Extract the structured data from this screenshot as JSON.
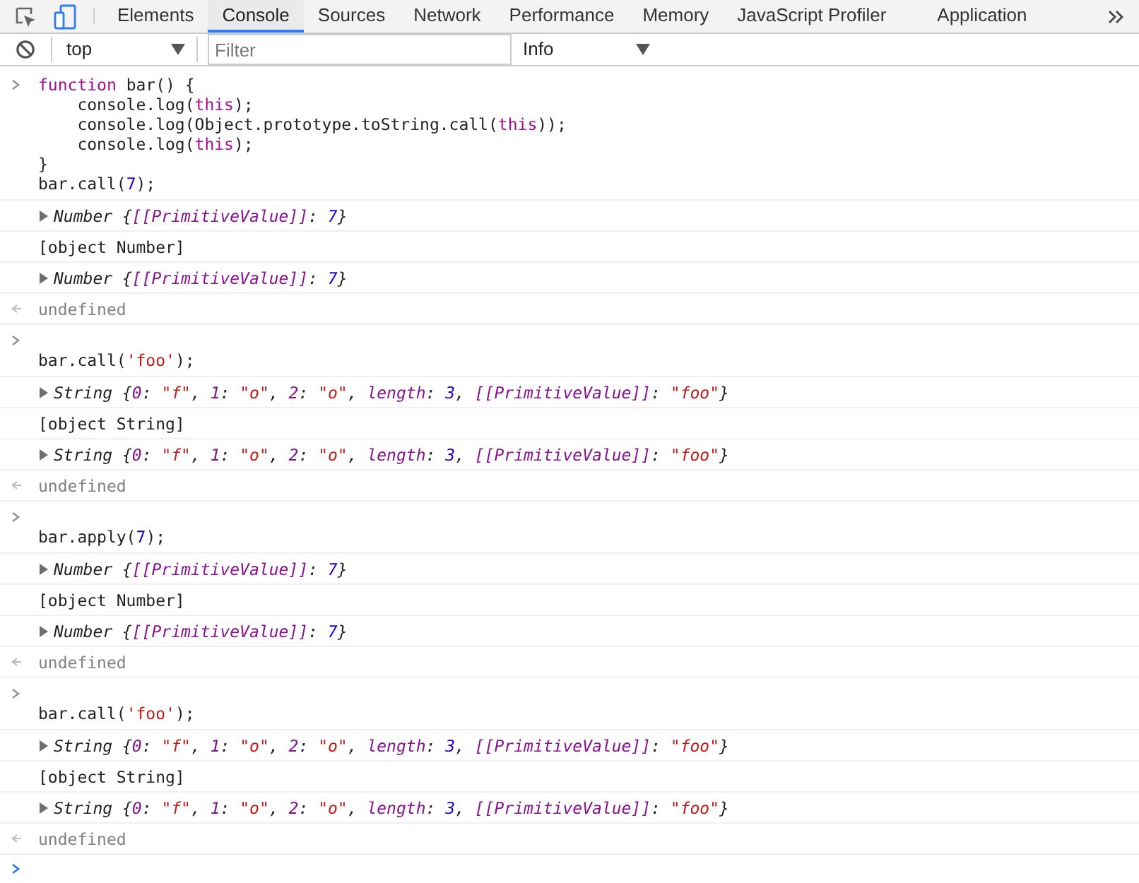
{
  "tabs": [
    {
      "label": "Elements",
      "selected": false
    },
    {
      "label": "Console",
      "selected": true
    },
    {
      "label": "Sources",
      "selected": false
    },
    {
      "label": "Network",
      "selected": false
    },
    {
      "label": "Performance",
      "selected": false
    },
    {
      "label": "Memory",
      "selected": false
    },
    {
      "label": "JavaScript Profiler",
      "selected": false
    },
    {
      "label": "Application",
      "selected": false
    }
  ],
  "toolbar": {
    "context": "top",
    "filter": {
      "placeholder": "Filter"
    },
    "level": "Info"
  },
  "console": [
    {
      "kind": "input",
      "blank_first_line": false,
      "lines": [
        [
          {
            "kind": "keyword",
            "text": "function"
          },
          {
            "kind": "plain",
            "text": " bar() {"
          }
        ],
        [
          {
            "kind": "plain",
            "text": "    console.log("
          },
          {
            "kind": "keyword",
            "text": "this"
          },
          {
            "kind": "plain",
            "text": ");"
          }
        ],
        [
          {
            "kind": "plain",
            "text": "    console.log(Object.prototype.toString.call("
          },
          {
            "kind": "keyword",
            "text": "this"
          },
          {
            "kind": "plain",
            "text": "));"
          }
        ],
        [
          {
            "kind": "plain",
            "text": "    console.log("
          },
          {
            "kind": "keyword",
            "text": "this"
          },
          {
            "kind": "plain",
            "text": ");"
          }
        ],
        [
          {
            "kind": "plain",
            "text": "}"
          }
        ],
        [
          {
            "kind": "plain",
            "text": "bar.call("
          },
          {
            "kind": "number",
            "text": "7"
          },
          {
            "kind": "plain",
            "text": ");"
          }
        ]
      ]
    },
    {
      "kind": "object",
      "expanded": false,
      "tokens": [
        {
          "kind": "plain",
          "text": "Number {"
        },
        {
          "kind": "prop",
          "text": "[[PrimitiveValue]]"
        },
        {
          "kind": "plain",
          "text": ": "
        },
        {
          "kind": "number",
          "text": "7"
        },
        {
          "kind": "plain",
          "text": "}"
        }
      ]
    },
    {
      "kind": "text",
      "text": "[object Number]"
    },
    {
      "kind": "object",
      "expanded": false,
      "tokens": [
        {
          "kind": "plain",
          "text": "Number {"
        },
        {
          "kind": "prop",
          "text": "[[PrimitiveValue]]"
        },
        {
          "kind": "plain",
          "text": ": "
        },
        {
          "kind": "number",
          "text": "7"
        },
        {
          "kind": "plain",
          "text": "}"
        }
      ]
    },
    {
      "kind": "result",
      "text": "undefined"
    },
    {
      "kind": "input",
      "blank_first_line": true,
      "lines": [
        [
          {
            "kind": "plain",
            "text": "bar.call("
          },
          {
            "kind": "string",
            "text": "'foo'"
          },
          {
            "kind": "plain",
            "text": ");"
          }
        ]
      ]
    },
    {
      "kind": "object",
      "expanded": false,
      "tokens": [
        {
          "kind": "plain",
          "text": "String {"
        },
        {
          "kind": "prop",
          "text": "0"
        },
        {
          "kind": "plain",
          "text": ": "
        },
        {
          "kind": "string",
          "text": "\"f\""
        },
        {
          "kind": "plain",
          "text": ", "
        },
        {
          "kind": "prop",
          "text": "1"
        },
        {
          "kind": "plain",
          "text": ": "
        },
        {
          "kind": "string",
          "text": "\"o\""
        },
        {
          "kind": "plain",
          "text": ", "
        },
        {
          "kind": "prop",
          "text": "2"
        },
        {
          "kind": "plain",
          "text": ": "
        },
        {
          "kind": "string",
          "text": "\"o\""
        },
        {
          "kind": "plain",
          "text": ", "
        },
        {
          "kind": "prop",
          "text": "length"
        },
        {
          "kind": "plain",
          "text": ": "
        },
        {
          "kind": "number",
          "text": "3"
        },
        {
          "kind": "plain",
          "text": ", "
        },
        {
          "kind": "prop",
          "text": "[[PrimitiveValue]]"
        },
        {
          "kind": "plain",
          "text": ": "
        },
        {
          "kind": "string",
          "text": "\"foo\""
        },
        {
          "kind": "plain",
          "text": "}"
        }
      ]
    },
    {
      "kind": "text",
      "text": "[object String]"
    },
    {
      "kind": "object",
      "expanded": false,
      "tokens": [
        {
          "kind": "plain",
          "text": "String {"
        },
        {
          "kind": "prop",
          "text": "0"
        },
        {
          "kind": "plain",
          "text": ": "
        },
        {
          "kind": "string",
          "text": "\"f\""
        },
        {
          "kind": "plain",
          "text": ", "
        },
        {
          "kind": "prop",
          "text": "1"
        },
        {
          "kind": "plain",
          "text": ": "
        },
        {
          "kind": "string",
          "text": "\"o\""
        },
        {
          "kind": "plain",
          "text": ", "
        },
        {
          "kind": "prop",
          "text": "2"
        },
        {
          "kind": "plain",
          "text": ": "
        },
        {
          "kind": "string",
          "text": "\"o\""
        },
        {
          "kind": "plain",
          "text": ", "
        },
        {
          "kind": "prop",
          "text": "length"
        },
        {
          "kind": "plain",
          "text": ": "
        },
        {
          "kind": "number",
          "text": "3"
        },
        {
          "kind": "plain",
          "text": ", "
        },
        {
          "kind": "prop",
          "text": "[[PrimitiveValue]]"
        },
        {
          "kind": "plain",
          "text": ": "
        },
        {
          "kind": "string",
          "text": "\"foo\""
        },
        {
          "kind": "plain",
          "text": "}"
        }
      ]
    },
    {
      "kind": "result",
      "text": "undefined"
    },
    {
      "kind": "input",
      "blank_first_line": true,
      "lines": [
        [
          {
            "kind": "plain",
            "text": "bar.apply("
          },
          {
            "kind": "number",
            "text": "7"
          },
          {
            "kind": "plain",
            "text": ");"
          }
        ]
      ]
    },
    {
      "kind": "object",
      "expanded": false,
      "tokens": [
        {
          "kind": "plain",
          "text": "Number {"
        },
        {
          "kind": "prop",
          "text": "[[PrimitiveValue]]"
        },
        {
          "kind": "plain",
          "text": ": "
        },
        {
          "kind": "number",
          "text": "7"
        },
        {
          "kind": "plain",
          "text": "}"
        }
      ]
    },
    {
      "kind": "text",
      "text": "[object Number]"
    },
    {
      "kind": "object",
      "expanded": false,
      "tokens": [
        {
          "kind": "plain",
          "text": "Number {"
        },
        {
          "kind": "prop",
          "text": "[[PrimitiveValue]]"
        },
        {
          "kind": "plain",
          "text": ": "
        },
        {
          "kind": "number",
          "text": "7"
        },
        {
          "kind": "plain",
          "text": "}"
        }
      ]
    },
    {
      "kind": "result",
      "text": "undefined"
    },
    {
      "kind": "input",
      "blank_first_line": true,
      "lines": [
        [
          {
            "kind": "plain",
            "text": "bar.call("
          },
          {
            "kind": "string",
            "text": "'foo'"
          },
          {
            "kind": "plain",
            "text": ");"
          }
        ]
      ]
    },
    {
      "kind": "object",
      "expanded": false,
      "tokens": [
        {
          "kind": "plain",
          "text": "String {"
        },
        {
          "kind": "prop",
          "text": "0"
        },
        {
          "kind": "plain",
          "text": ": "
        },
        {
          "kind": "string",
          "text": "\"f\""
        },
        {
          "kind": "plain",
          "text": ", "
        },
        {
          "kind": "prop",
          "text": "1"
        },
        {
          "kind": "plain",
          "text": ": "
        },
        {
          "kind": "string",
          "text": "\"o\""
        },
        {
          "kind": "plain",
          "text": ", "
        },
        {
          "kind": "prop",
          "text": "2"
        },
        {
          "kind": "plain",
          "text": ": "
        },
        {
          "kind": "string",
          "text": "\"o\""
        },
        {
          "kind": "plain",
          "text": ", "
        },
        {
          "kind": "prop",
          "text": "length"
        },
        {
          "kind": "plain",
          "text": ": "
        },
        {
          "kind": "number",
          "text": "3"
        },
        {
          "kind": "plain",
          "text": ", "
        },
        {
          "kind": "prop",
          "text": "[[PrimitiveValue]]"
        },
        {
          "kind": "plain",
          "text": ": "
        },
        {
          "kind": "string",
          "text": "\"foo\""
        },
        {
          "kind": "plain",
          "text": "}"
        }
      ]
    },
    {
      "kind": "text",
      "text": "[object String]"
    },
    {
      "kind": "object",
      "expanded": false,
      "tokens": [
        {
          "kind": "plain",
          "text": "String {"
        },
        {
          "kind": "prop",
          "text": "0"
        },
        {
          "kind": "plain",
          "text": ": "
        },
        {
          "kind": "string",
          "text": "\"f\""
        },
        {
          "kind": "plain",
          "text": ", "
        },
        {
          "kind": "prop",
          "text": "1"
        },
        {
          "kind": "plain",
          "text": ": "
        },
        {
          "kind": "string",
          "text": "\"o\""
        },
        {
          "kind": "plain",
          "text": ", "
        },
        {
          "kind": "prop",
          "text": "2"
        },
        {
          "kind": "plain",
          "text": ": "
        },
        {
          "kind": "string",
          "text": "\"o\""
        },
        {
          "kind": "plain",
          "text": ", "
        },
        {
          "kind": "prop",
          "text": "length"
        },
        {
          "kind": "plain",
          "text": ": "
        },
        {
          "kind": "number",
          "text": "3"
        },
        {
          "kind": "plain",
          "text": ", "
        },
        {
          "kind": "prop",
          "text": "[[PrimitiveValue]]"
        },
        {
          "kind": "plain",
          "text": ": "
        },
        {
          "kind": "string",
          "text": "\"foo\""
        },
        {
          "kind": "plain",
          "text": "}"
        }
      ]
    },
    {
      "kind": "result",
      "text": "undefined"
    },
    {
      "kind": "prompt"
    }
  ]
}
